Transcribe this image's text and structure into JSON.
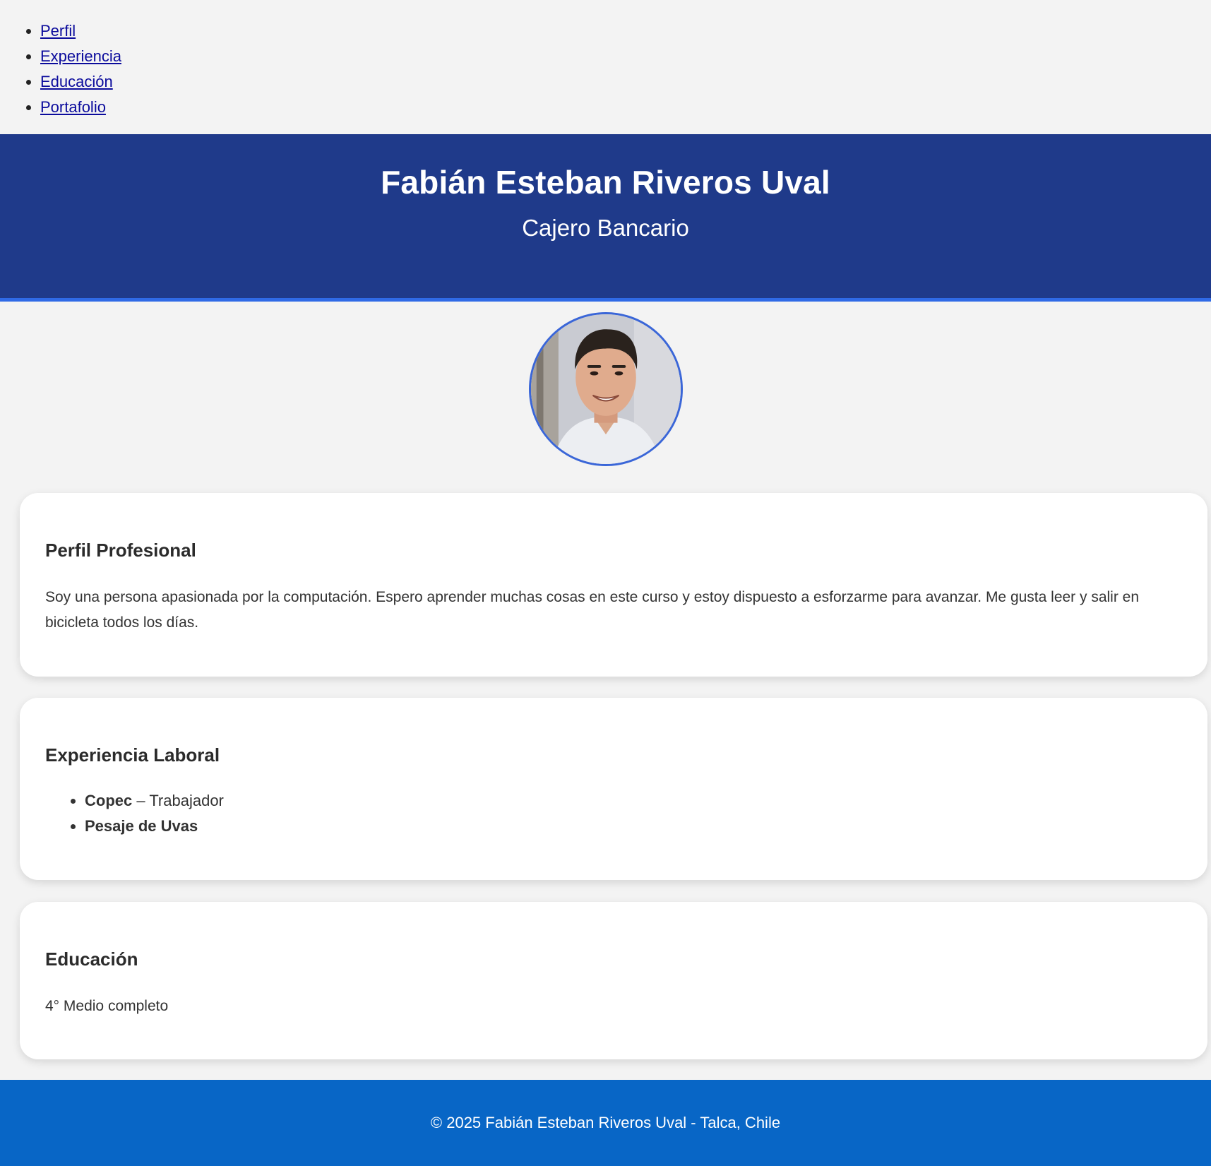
{
  "nav": {
    "items": [
      {
        "label": "Perfil"
      },
      {
        "label": "Experiencia"
      },
      {
        "label": "Educación"
      },
      {
        "label": "Portafolio"
      }
    ]
  },
  "header": {
    "name": "Fabián Esteban Riveros Uval",
    "role": "Cajero Bancario"
  },
  "profile_section": {
    "title": "Perfil Profesional",
    "text": "Soy una persona apasionada por la computación. Espero aprender muchas cosas en este curso y estoy dispuesto a esforzarme para avanzar. Me gusta leer y salir en bicicleta todos los días."
  },
  "experience_section": {
    "title": "Experiencia Laboral",
    "items": [
      {
        "company": "Copec",
        "detail": " – Trabajador"
      },
      {
        "company": "Pesaje de Uvas",
        "detail": ""
      }
    ]
  },
  "education_section": {
    "title": "Educación",
    "text": "4° Medio completo"
  },
  "footer": {
    "text": "© 2025 Fabián Esteban Riveros Uval - Talca, Chile"
  },
  "colors": {
    "header_bg": "#1f3a8a",
    "header_border": "#2f6ae6",
    "footer_bg": "#0866c6",
    "page_bg": "#f3f3f3",
    "link": "#0b0b9c"
  }
}
